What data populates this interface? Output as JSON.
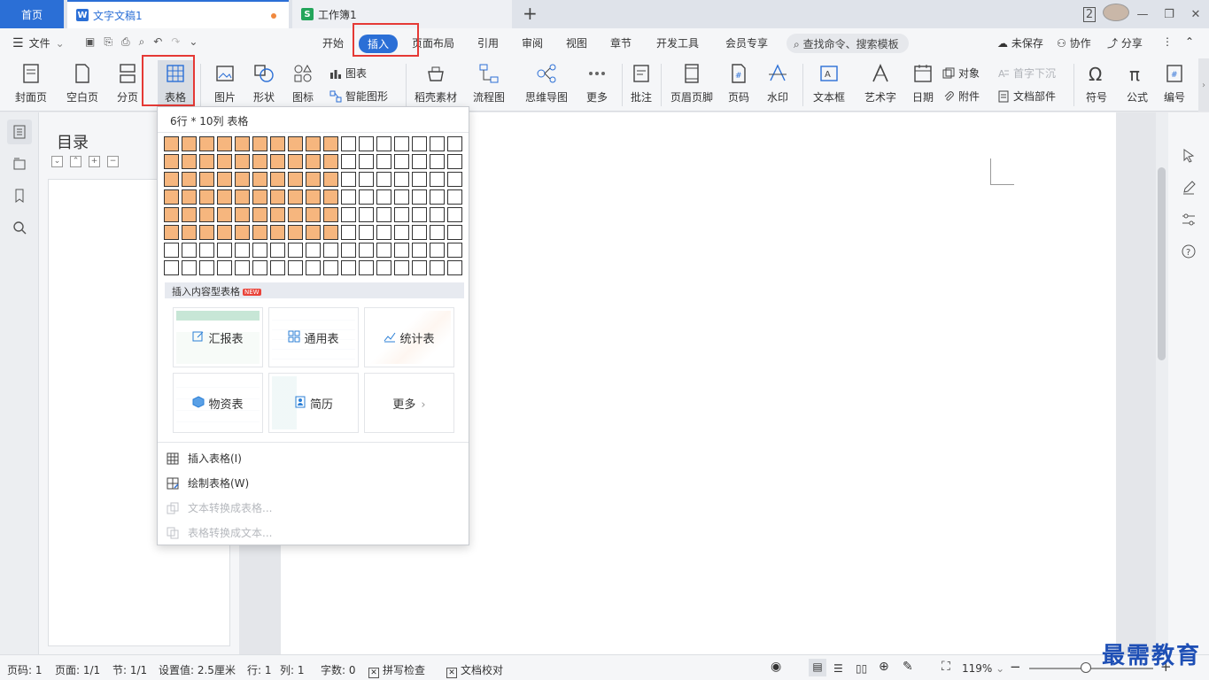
{
  "tabs": {
    "home": "首页",
    "doc": "文字文稿1",
    "sheet": "工作簿1",
    "window_badge": "2"
  },
  "menu": {
    "file": "文件",
    "items": [
      "开始",
      "插入",
      "页面布局",
      "引用",
      "审阅",
      "视图",
      "章节",
      "开发工具",
      "会员专享"
    ],
    "search_placeholder": "查找命令、搜索模板",
    "unsaved": "未保存",
    "collab": "协作",
    "share": "分享"
  },
  "ribbon": {
    "cover": "封面页",
    "blank": "空白页",
    "pagebreak": "分页",
    "table": "表格",
    "picture": "图片",
    "shape": "形状",
    "icon": "图标",
    "chart": "图表",
    "smartart": "智能图形",
    "straw": "稻壳素材",
    "flowchart": "流程图",
    "mindmap": "思维导图",
    "more": "更多",
    "comment": "批注",
    "headerfooter": "页眉页脚",
    "pagenum": "页码",
    "watermark": "水印",
    "textbox": "文本框",
    "wordart": "艺术字",
    "date": "日期",
    "object": "对象",
    "attachment": "附件",
    "dropcap": "首字下沉",
    "docparts": "文档部件",
    "symbol": "符号",
    "formula": "公式",
    "numbering": "编号"
  },
  "toc": {
    "title": "目录"
  },
  "dropdown": {
    "header": "6行 * 10列 表格",
    "grid": {
      "rows": 8,
      "cols": 17,
      "selected_rows": 6,
      "selected_cols": 10
    },
    "content_header": "插入内容型表格",
    "new_tag": "NEW",
    "cards": [
      "汇报表",
      "通用表",
      "统计表",
      "物资表",
      "简历",
      "更多"
    ],
    "actions": [
      {
        "label": "插入表格(I)",
        "enabled": true
      },
      {
        "label": "绘制表格(W)",
        "enabled": true
      },
      {
        "label": "文本转换成表格...",
        "enabled": false
      },
      {
        "label": "表格转换成文本...",
        "enabled": false
      }
    ]
  },
  "status": {
    "pageno": "页码: 1",
    "pages": "页面: 1/1",
    "section": "节: 1/1",
    "setting": "设置值: 2.5厘米",
    "row": "行: 1",
    "col": "列: 1",
    "words": "字数: 0",
    "spellcheck": "拼写检查",
    "proofread": "文档校对",
    "zoom": "119%",
    "zoom_fraction": 0.46
  },
  "watermark_text": "最需教育",
  "colors": {
    "accent": "#2b6fd6",
    "selected_cell": "#f6b67e",
    "highlight": "#e53935"
  }
}
